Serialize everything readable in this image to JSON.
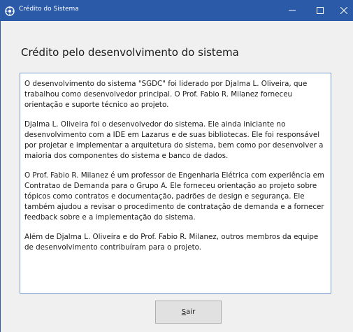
{
  "window": {
    "title": "Crédito do Sistema",
    "accent_color": "#2b5aa8",
    "icon": "app-icon",
    "controls": [
      "minimize-icon",
      "maximize-icon",
      "close-icon"
    ]
  },
  "main": {
    "heading": "Crédito pelo desenvolvimento do sistema",
    "paragraphs": [
      "O desenvolvimento do sistema \"SGDC\" foi liderado por Djalma L. Oliveira, que trabalhou como desenvolvedor principal. O Prof. Fabio R. Milanez forneceu orientação e suporte técnico ao projeto.",
      "Djalma L. Oliveira foi o desenvolvedor do sistema. Ele ainda iniciante no desenvolvimento com a IDE em Lazarus e de suas bibliotecas. Ele foi responsável por projetar e implementar a arquitetura do sistema, bem como por desenvolver a maioria dos componentes do sistema e banco de dados.",
      "O Prof. Fabio R. Milanez é um professor de Engenharia Elétrica com experiência em Contratao de Demanda para o Grupo A. Ele forneceu orientação ao projeto sobre tópicos como contratos e documentação, padrões de design e segurança. Ele também ajudou a revisar o procedimento de contratação de demanda e a fornecer feedback sobre e a implementação do sistema.",
      "Além de Djalma L. Oliveira e do Prof. Fabio R. Milanez, outros membros da equipe de desenvolvimento contribuíram para o projeto."
    ]
  },
  "footer": {
    "exit_button": {
      "mnemonic": "S",
      "rest": "air"
    }
  }
}
